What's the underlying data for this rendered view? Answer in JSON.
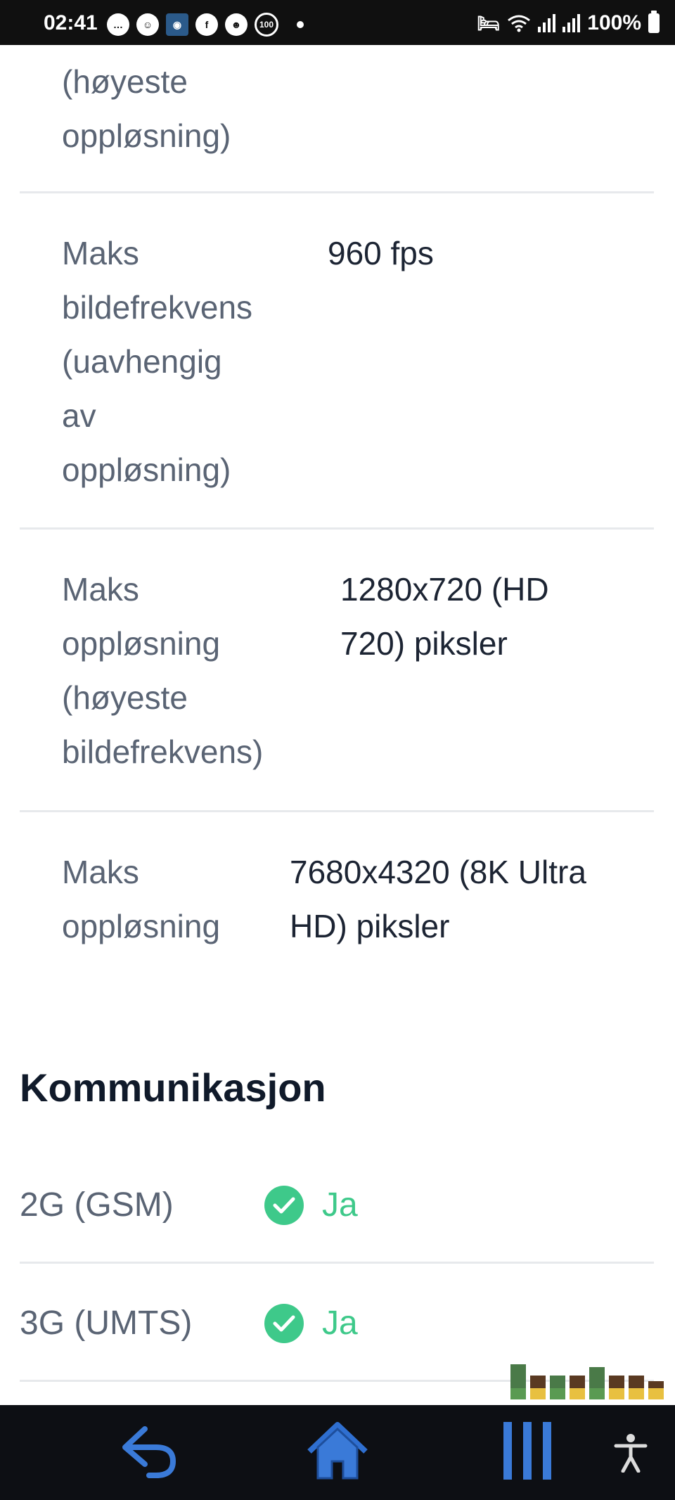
{
  "status_bar": {
    "time": "02:41",
    "notification_icons": [
      "messenger-icon",
      "discord-like-icon",
      "app-icon",
      "facebook-icon",
      "discord-icon",
      "hundred-badge-icon"
    ],
    "battery": "100%"
  },
  "specs": [
    {
      "label_lines": [
        "(høyeste",
        "oppløsning)"
      ],
      "value_lines": []
    },
    {
      "label_lines": [
        "Maks",
        "bildefrekvens",
        "(uavhengig",
        "av",
        "oppløsning)"
      ],
      "value_lines": [
        "960 fps"
      ]
    },
    {
      "label_lines": [
        "Maks",
        "oppløsning",
        "(høyeste",
        "bildefrekvens)"
      ],
      "value_lines": [
        "1280x720 (HD",
        "720) piksler"
      ]
    },
    {
      "label_lines": [
        "Maks",
        "oppløsning"
      ],
      "value_lines": [
        "7680x4320 (8K Ultra",
        "HD) piksler"
      ]
    }
  ],
  "communication": {
    "title": "Kommunikasjon",
    "rows": [
      {
        "label": "2G (GSM)",
        "value": "Ja"
      },
      {
        "label": "3G (UMTS)",
        "value": "Ja"
      }
    ]
  },
  "nav": {
    "back": "back-icon",
    "home": "home-icon",
    "recents": "recents-icon",
    "accessibility": "accessibility-icon"
  }
}
